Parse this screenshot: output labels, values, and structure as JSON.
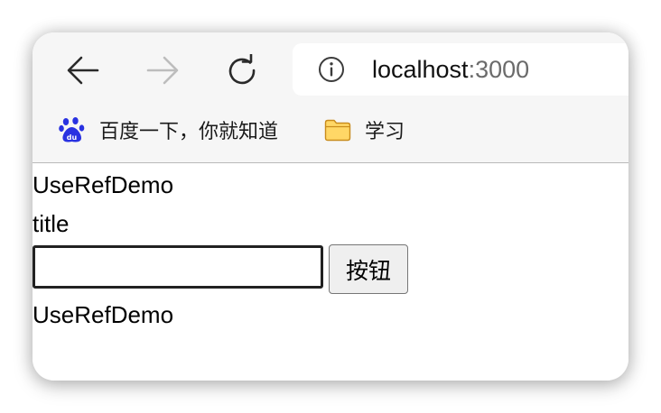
{
  "browser": {
    "url_host": "localhost",
    "url_port": ":3000",
    "icons": {
      "back": "back-arrow-icon",
      "forward": "forward-arrow-icon",
      "reload": "reload-icon",
      "info": "info-icon"
    },
    "bookmarks": [
      {
        "label": "百度一下，你就知道",
        "icon": "baidu-paw-icon"
      },
      {
        "label": "学习",
        "icon": "folder-icon"
      }
    ]
  },
  "page": {
    "heading": "UseRefDemo",
    "title_text": "title",
    "input": {
      "value": "",
      "placeholder": ""
    },
    "button_label": "按钮",
    "footer_text": "UseRefDemo"
  },
  "colors": {
    "toolbar_bg": "#f6f6f6",
    "baidu_blue": "#2932e1",
    "folder_yellow": "#ffd766"
  }
}
